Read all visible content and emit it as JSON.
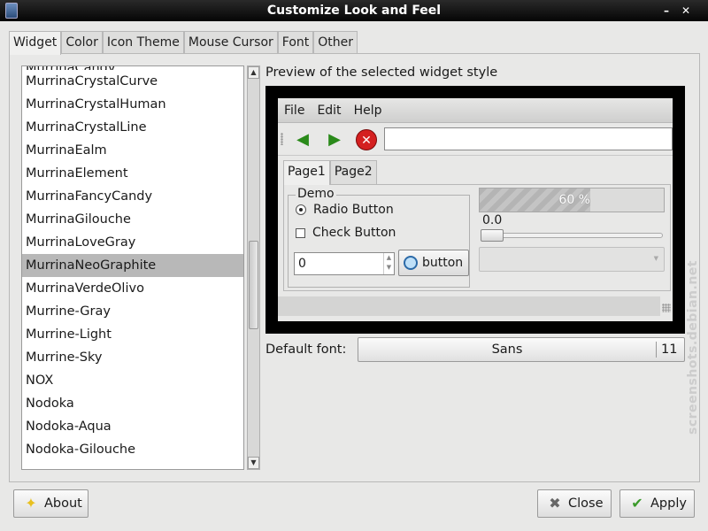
{
  "window": {
    "title": "Customize Look and Feel",
    "minimize_glyph": "–",
    "close_glyph": "✕"
  },
  "tabs": [
    "Widget",
    "Color",
    "Icon Theme",
    "Mouse Cursor",
    "Font",
    "Other"
  ],
  "active_tab": "Widget",
  "theme_list": {
    "partial_top": "MurrinaCandy",
    "items": [
      "MurrinaCrystalCurve",
      "MurrinaCrystalHuman",
      "MurrinaCrystalLine",
      "MurrinaEalm",
      "MurrinaElement",
      "MurrinaFancyCandy",
      "MurrinaGilouche",
      "MurrinaLoveGray",
      "MurrinaNeoGraphite",
      "MurrinaVerdeOlivo",
      "Murrine-Gray",
      "Murrine-Light",
      "Murrine-Sky",
      "NOX",
      "Nodoka",
      "Nodoka-Aqua",
      "Nodoka-Gilouche"
    ],
    "selected": "MurrinaNeoGraphite"
  },
  "preview": {
    "label": "Preview of the selected widget style",
    "menu": [
      "File",
      "Edit",
      "Help"
    ],
    "toolbar_icons": [
      "back-arrow-icon",
      "forward-arrow-icon",
      "stop-icon"
    ],
    "tabs": [
      "Page1",
      "Page2"
    ],
    "demo_title": "Demo",
    "radio_label": "Radio Button",
    "check_label": "Check Button",
    "spin_value": "0",
    "button_label": "button",
    "progress_text": "60 %",
    "progress_fraction": 0.6,
    "scale_value": "0.0"
  },
  "font": {
    "label": "Default font:",
    "name": "Sans",
    "size": "11"
  },
  "buttons": {
    "about": "About",
    "close": "Close",
    "apply": "Apply"
  },
  "watermark": "screenshots.debian.net"
}
